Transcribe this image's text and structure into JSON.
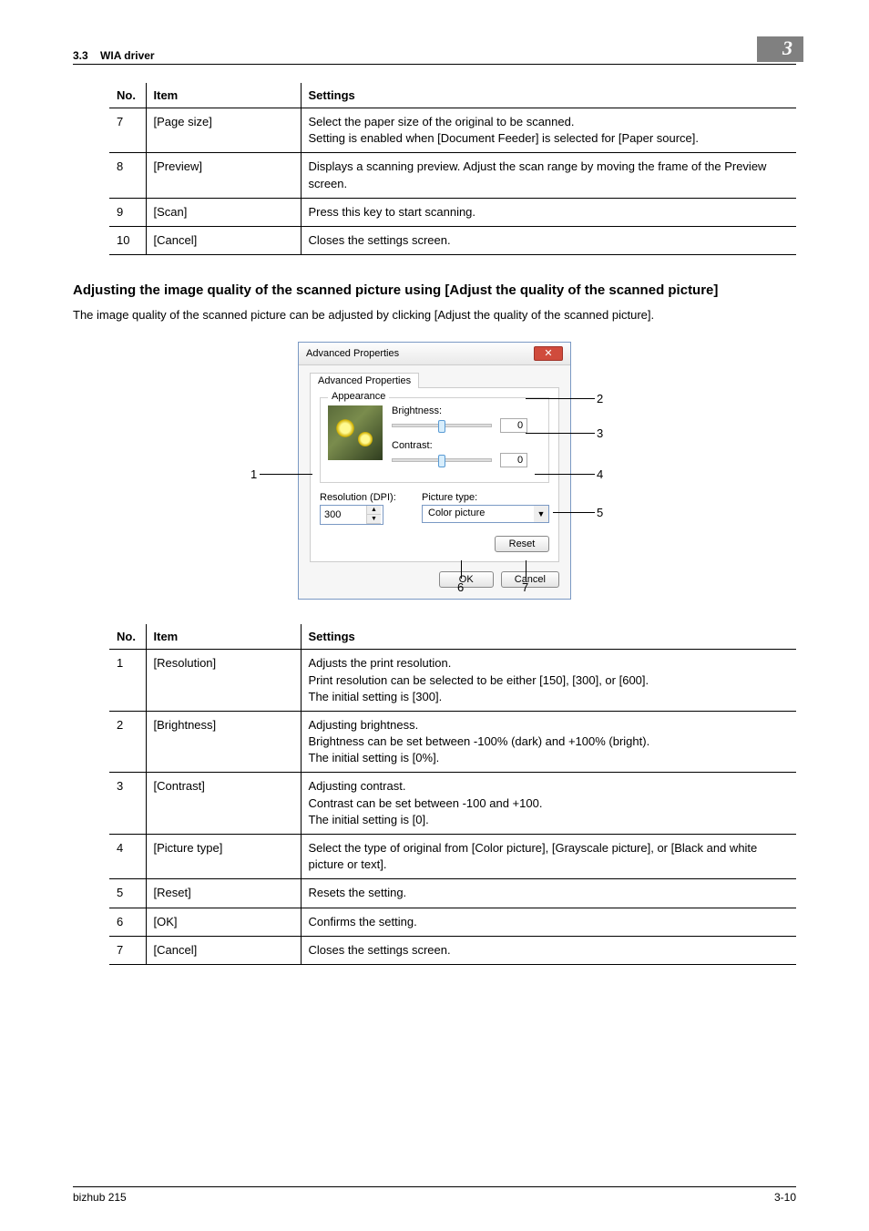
{
  "header": {
    "section_number": "3.3",
    "section_title": "WIA driver",
    "chapter_number": "3"
  },
  "table1": {
    "headers": {
      "no": "No.",
      "item": "Item",
      "settings": "Settings"
    },
    "rows": [
      {
        "no": "7",
        "item": "[Page size]",
        "settings": "Select the paper size of the original to be scanned.\nSetting is enabled when [Document Feeder] is selected for [Paper source]."
      },
      {
        "no": "8",
        "item": "[Preview]",
        "settings": "Displays a scanning preview. Adjust the scan range by moving the frame of the Preview screen."
      },
      {
        "no": "9",
        "item": "[Scan]",
        "settings": "Press this key to start scanning."
      },
      {
        "no": "10",
        "item": "[Cancel]",
        "settings": "Closes the settings screen."
      }
    ]
  },
  "section_heading": "Adjusting the image quality of the scanned picture using [Adjust the quality of the scanned picture]",
  "body_text": "The image quality of the scanned picture can be adjusted by clicking [Adjust the quality of the scanned picture].",
  "dialog": {
    "title": "Advanced Properties",
    "tab": "Advanced Properties",
    "group_label": "Appearance",
    "brightness_label": "Brightness:",
    "brightness_value": "0",
    "contrast_label": "Contrast:",
    "contrast_value": "0",
    "resolution_label": "Resolution (DPI):",
    "resolution_value": "300",
    "picture_type_label": "Picture type:",
    "picture_type_value": "Color picture",
    "reset": "Reset",
    "ok": "OK",
    "cancel": "Cancel"
  },
  "callouts": {
    "c1": "1",
    "c2": "2",
    "c3": "3",
    "c4": "4",
    "c5": "5",
    "c6": "6",
    "c7": "7"
  },
  "table2": {
    "headers": {
      "no": "No.",
      "item": "Item",
      "settings": "Settings"
    },
    "rows": [
      {
        "no": "1",
        "item": "[Resolution]",
        "settings": "Adjusts the print resolution.\nPrint resolution can be selected to be either [150], [300], or [600].\nThe initial setting is [300]."
      },
      {
        "no": "2",
        "item": "[Brightness]",
        "settings": "Adjusting brightness.\nBrightness can be set between -100% (dark) and +100% (bright).\nThe initial setting is [0%]."
      },
      {
        "no": "3",
        "item": "[Contrast]",
        "settings": "Adjusting contrast.\nContrast can be set between -100 and +100.\nThe initial setting is [0]."
      },
      {
        "no": "4",
        "item": "[Picture type]",
        "settings": "Select the type of original from [Color picture], [Grayscale picture], or [Black and white picture or text]."
      },
      {
        "no": "5",
        "item": "[Reset]",
        "settings": "Resets the setting."
      },
      {
        "no": "6",
        "item": "[OK]",
        "settings": "Confirms the setting."
      },
      {
        "no": "7",
        "item": "[Cancel]",
        "settings": "Closes the settings screen."
      }
    ]
  },
  "footer": {
    "left": "bizhub 215",
    "right": "3-10"
  }
}
